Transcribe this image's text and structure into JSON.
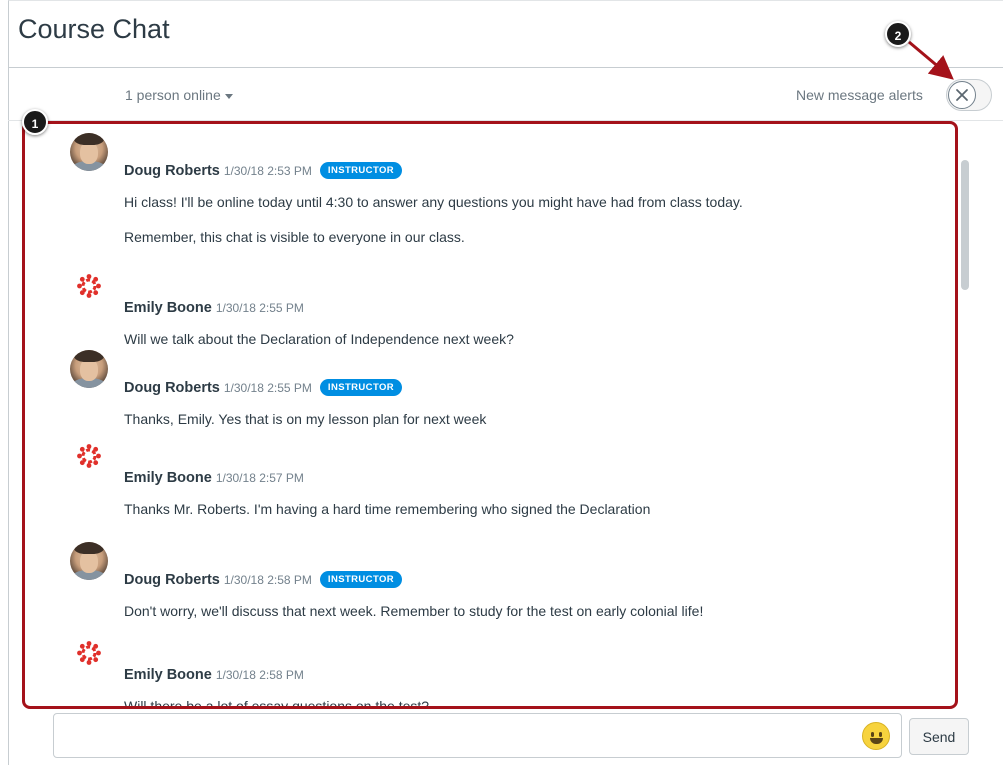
{
  "header": {
    "title": "Course Chat",
    "online_label": "1 person online",
    "alerts_label": "New message alerts",
    "alerts_enabled": false
  },
  "callouts": [
    "1",
    "2"
  ],
  "colors": {
    "badge": "#008ee2",
    "highlight": "#a4121a",
    "emoji": "#f7d33e"
  },
  "messages": [
    {
      "name": "Doug Roberts",
      "time": "1/30/18 2:53 PM",
      "badge": "INSTRUCTOR",
      "avatar": "user-photo-icon",
      "lines": [
        "Hi class! I'll be online today until 4:30 to answer any questions you might have had from class today.",
        "Remember, this chat is visible to everyone in our class."
      ]
    },
    {
      "name": "Emily Boone",
      "time": "1/30/18 2:55 PM",
      "avatar": "canvas-logo-icon",
      "lines": [
        "Will we talk about the Declaration of Independence next week?"
      ]
    },
    {
      "name": "Doug Roberts",
      "time": "1/30/18 2:55 PM",
      "badge": "INSTRUCTOR",
      "avatar": "user-photo-icon",
      "lines": [
        "Thanks, Emily. Yes that is on my lesson plan for next week"
      ]
    },
    {
      "name": "Emily Boone",
      "time": "1/30/18 2:57 PM",
      "avatar": "canvas-logo-icon",
      "lines": [
        "Thanks Mr. Roberts. I'm having a hard time remembering who signed the Declaration"
      ]
    },
    {
      "name": "Doug Roberts",
      "time": "1/30/18 2:58 PM",
      "badge": "INSTRUCTOR",
      "avatar": "user-photo-icon",
      "lines": [
        "Don't worry, we'll discuss that next week. Remember to study for the test on early colonial life!"
      ]
    },
    {
      "name": "Emily Boone",
      "time": "1/30/18 2:58 PM",
      "avatar": "canvas-logo-icon",
      "lines": [
        "Will there be a lot of essay questions on the test?"
      ]
    }
  ],
  "composer": {
    "send_label": "Send",
    "emoji_icon": "smiley-icon"
  }
}
